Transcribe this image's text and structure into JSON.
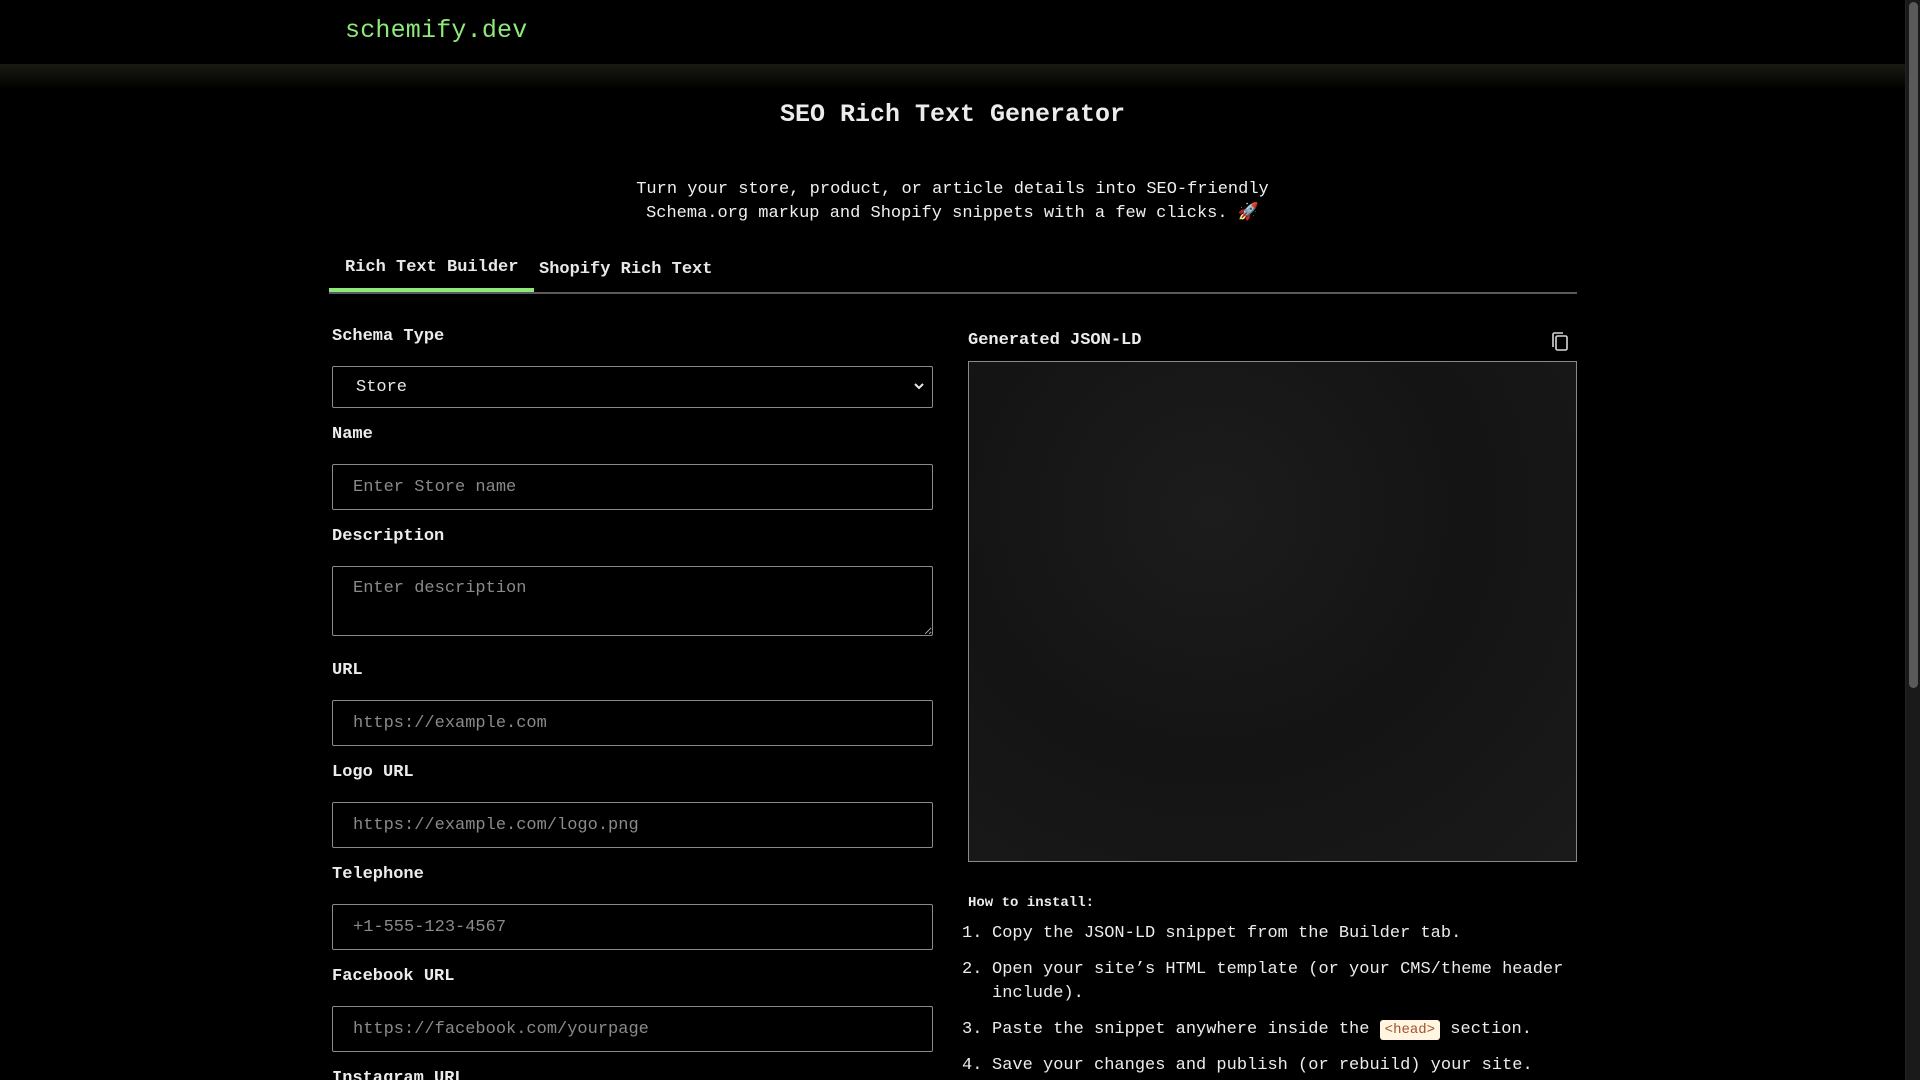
{
  "brand": "schemify.dev",
  "title": "SEO Rich Text Generator",
  "subtitle_line1": "Turn your store, product, or article details into SEO-friendly",
  "subtitle_line2": "Schema.org markup and Shopify snippets with a few clicks. 🚀",
  "tabs": [
    {
      "label": "Rich Text Builder",
      "active": true
    },
    {
      "label": "Shopify Rich Text",
      "active": false
    }
  ],
  "form": {
    "schema_type": {
      "label": "Schema Type",
      "value": "Store"
    },
    "name": {
      "label": "Name",
      "placeholder": "Enter Store name"
    },
    "description": {
      "label": "Description",
      "placeholder": "Enter description"
    },
    "url": {
      "label": "URL",
      "placeholder": "https://example.com"
    },
    "logo_url": {
      "label": "Logo URL",
      "placeholder": "https://example.com/logo.png"
    },
    "telephone": {
      "label": "Telephone",
      "placeholder": "+1-555-123-4567"
    },
    "facebook_url": {
      "label": "Facebook URL",
      "placeholder": "https://facebook.com/yourpage"
    },
    "instagram_url": {
      "label": "Instagram URL"
    }
  },
  "output": {
    "label": "Generated JSON-LD",
    "copy_icon": "copy-icon"
  },
  "howto": {
    "title": "How to install:",
    "steps": [
      {
        "num": "1.",
        "text": "Copy the JSON-LD snippet from the Builder tab."
      },
      {
        "num": "2.",
        "text": "Open your site’s HTML template (or your CMS/theme header include)."
      },
      {
        "num": "3.",
        "text_before": "Paste the snippet anywhere inside the",
        "code": "<head>",
        "text_after": "section."
      },
      {
        "num": "4.",
        "text": "Save your changes and publish (or rebuild) your site."
      }
    ]
  },
  "colors": {
    "accent": "#8fe87a",
    "background": "#000000",
    "border": "#8a8a8a"
  }
}
